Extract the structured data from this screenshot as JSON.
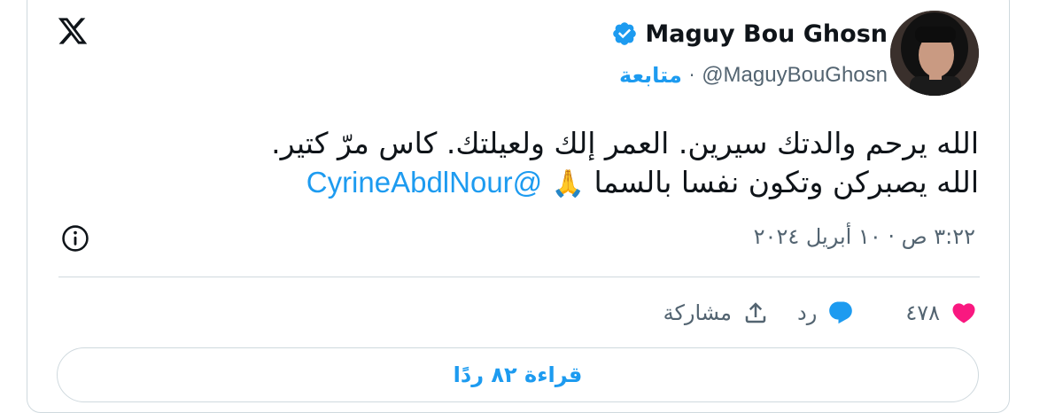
{
  "author": {
    "display_name": "Maguy Bou Ghosn",
    "handle": "@MaguyBouGhosn",
    "separator": "·",
    "follow_label": "متابعة",
    "verified": true
  },
  "tweet": {
    "line1": "الله يرحم والدتك سيرين. العمر إلك ولعيلتك. كاس مرّ كتير.",
    "line2": "الله يصبركن وتكون نفسا بالسما",
    "emoji": "🙏",
    "mention": "@CyrineAbdlNour",
    "timestamp": "٣:٢٢ ص · ١٠ أبريل ٢٠٢٤"
  },
  "actions": {
    "like_count": "٤٧٨",
    "reply_label": "رد",
    "share_label": "مشاركة"
  },
  "read_replies_label": "قراءة ٨٢ ردًا",
  "icons": {
    "brand": "x-logo-icon",
    "verified": "verified-badge-icon",
    "info": "info-icon",
    "like": "heart-icon",
    "reply": "speech-bubble-icon",
    "share": "share-upload-icon"
  },
  "colors": {
    "accent": "#1d9bf0",
    "like": "#f91880",
    "text": "#0f1419",
    "muted": "#536471",
    "border": "#cfd9de"
  }
}
